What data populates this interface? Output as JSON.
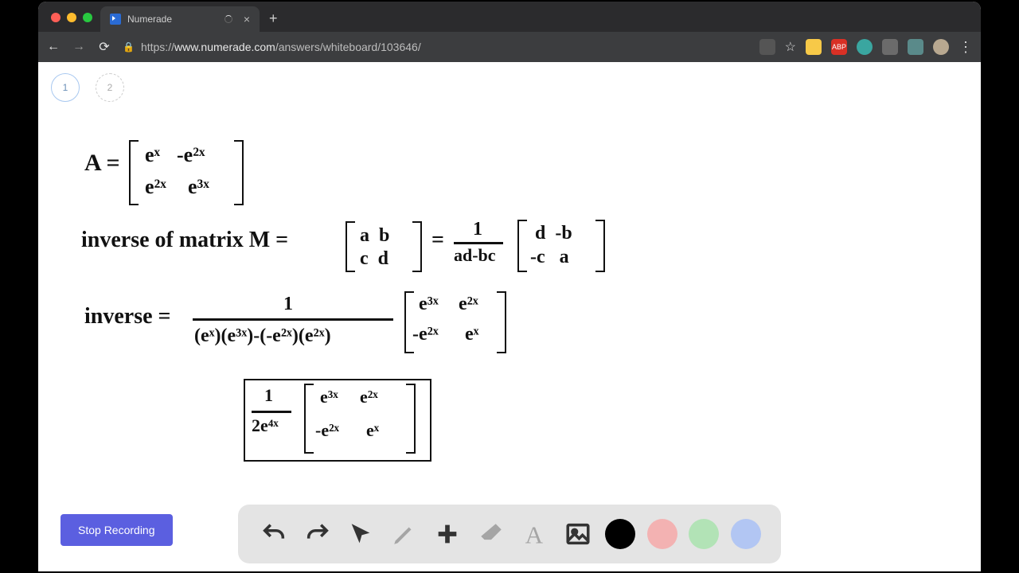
{
  "browser": {
    "tab_title": "Numerade",
    "url_scheme": "https://",
    "url_host": "www.numerade.com",
    "url_path": "/answers/whiteboard/103646/"
  },
  "page_nav": {
    "tabs": [
      "1",
      "2"
    ]
  },
  "buttons": {
    "stop_recording": "Stop Recording"
  },
  "toolbar": {
    "tools": [
      "undo",
      "redo",
      "pointer",
      "pen",
      "add",
      "eraser",
      "text",
      "image"
    ],
    "colors": {
      "black": "#000000",
      "pink": "#f3b2b2",
      "green": "#b2e3b6",
      "blue": "#b2c6f3"
    }
  },
  "whiteboard": {
    "line1_left": "A =",
    "line1_m11": "eˣ",
    "line1_m12": "-e²ˣ",
    "line1_m21": "e²ˣ",
    "line1_m22": "e³ˣ",
    "line2_text": "inverse of matrix M =",
    "line2_m": "a  b\nc  d",
    "line2_eq": "=",
    "line2_frac_top": "1",
    "line2_frac_bot": "ad-bc",
    "line2_r": " d  -b\n-c   a",
    "line3_left": "inverse =",
    "line3_frac_top": "1",
    "line3_frac_bot": "(eˣ)(e³ˣ)-(-e²ˣ)(e²ˣ)",
    "line3_m11": "e³ˣ",
    "line3_m12": "e²ˣ",
    "line3_m21": "-e²ˣ",
    "line3_m22": "eˣ",
    "line4_frac_top": "1",
    "line4_frac_bot": "2e⁴ˣ",
    "line4_m11": "e³ˣ",
    "line4_m12": "e²ˣ",
    "line4_m21": "-e²ˣ",
    "line4_m22": "eˣ"
  }
}
